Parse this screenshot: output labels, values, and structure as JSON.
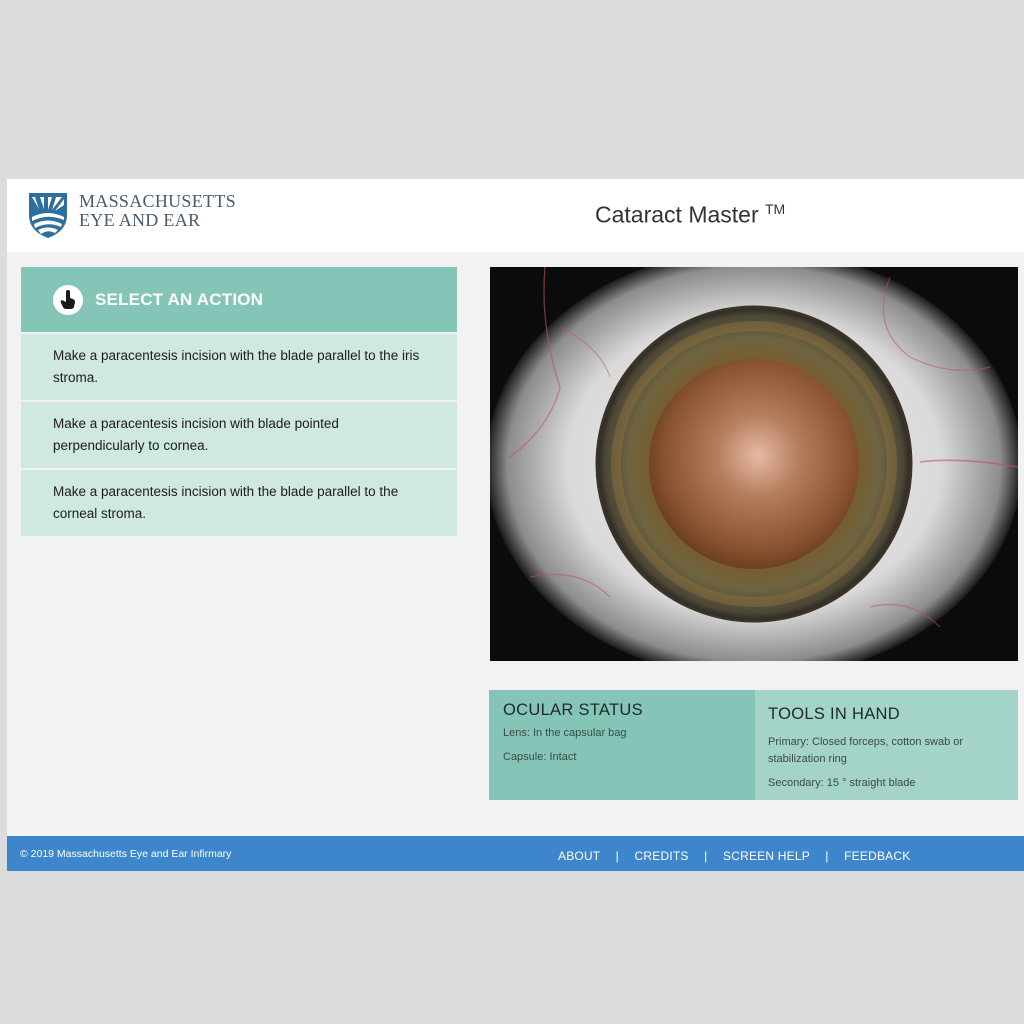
{
  "header": {
    "logo_line1": "MASSACHUSETTS",
    "logo_line2": "EYE AND EAR",
    "app_title": "Cataract Master",
    "trademark": "TM"
  },
  "actions": {
    "title": "SELECT AN ACTION",
    "items": [
      "Make a paracentesis incision with the blade parallel to the iris stroma.",
      "Make a paracentesis incision with blade pointed perpendicularly to cornea.",
      "Make a paracentesis incision with the blade parallel to the corneal stroma."
    ]
  },
  "ocular_status": {
    "title": "OCULAR STATUS",
    "lens": "Lens: In the capsular bag",
    "capsule": "Capsule: Intact"
  },
  "tools_in_hand": {
    "title": "TOOLS IN HAND",
    "primary_line1": "Primary: Closed forceps, cotton swab or",
    "primary_line2": "stabilization ring",
    "secondary": "Secondary: 15 ° straight blade"
  },
  "footer": {
    "copyright": "© 2019 Massachusetts Eye and Ear Infirmary",
    "links": [
      "ABOUT",
      "CREDITS",
      "SCREEN HELP",
      "FEEDBACK"
    ],
    "separator": "|"
  },
  "colors": {
    "teal_header": "#84c5b8",
    "teal_item": "#cfe8e2",
    "teal_tools": "#a4d3c9",
    "footer_blue": "#3e86cc"
  },
  "icons": {
    "logo": "massachusetts-eye-and-ear-shield-icon",
    "action": "hand-pointer-icon"
  }
}
